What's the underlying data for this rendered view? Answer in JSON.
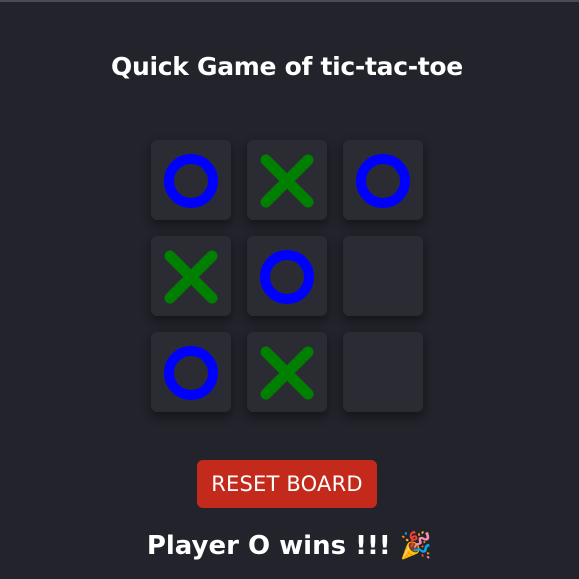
{
  "game": {
    "title": "Quick Game of tic-tac-toe",
    "board": [
      "O",
      "X",
      "O",
      "X",
      "O",
      "",
      "O",
      "X",
      ""
    ],
    "colors": {
      "O": "#0000ff",
      "X": "#008000",
      "cell_background": "#2b2c33",
      "page_background": "#22232b",
      "reset_button": "#c42a1c"
    },
    "reset_label": "RESET BOARD",
    "status_text": "Player O wins !!! 🎉"
  }
}
